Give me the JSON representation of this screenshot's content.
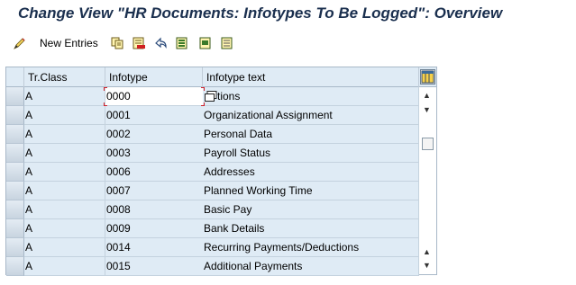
{
  "window": {
    "title": "Change View \"HR Documents: Infotypes To Be Logged\": Overview"
  },
  "toolbar": {
    "new_entries_label": "New Entries",
    "icons": [
      "change-display-icon",
      "copy-icon",
      "delete-icon",
      "undo-icon",
      "select-all-icon",
      "select-block-icon",
      "deselect-all-icon"
    ]
  },
  "table": {
    "headers": {
      "tr_class": "Tr.Class",
      "infotype": "Infotype",
      "infotype_text": "Infotype text"
    },
    "rows": [
      {
        "tr_class": "A",
        "infotype": "0000",
        "text": "tions"
      },
      {
        "tr_class": "A",
        "infotype": "0001",
        "text": "Organizational Assignment"
      },
      {
        "tr_class": "A",
        "infotype": "0002",
        "text": "Personal Data"
      },
      {
        "tr_class": "A",
        "infotype": "0003",
        "text": "Payroll Status"
      },
      {
        "tr_class": "A",
        "infotype": "0006",
        "text": "Addresses"
      },
      {
        "tr_class": "A",
        "infotype": "0007",
        "text": "Planned Working Time"
      },
      {
        "tr_class": "A",
        "infotype": "0008",
        "text": "Basic Pay"
      },
      {
        "tr_class": "A",
        "infotype": "0009",
        "text": "Bank Details"
      },
      {
        "tr_class": "A",
        "infotype": "0014",
        "text": "Recurring Payments/Deductions"
      },
      {
        "tr_class": "A",
        "infotype": "0015",
        "text": "Additional Payments"
      }
    ]
  },
  "colors": {
    "title": "#1a2f4e",
    "table_bg": "#dfebf5",
    "border": "#a8b8c8",
    "focus_mark": "#d0202a"
  }
}
